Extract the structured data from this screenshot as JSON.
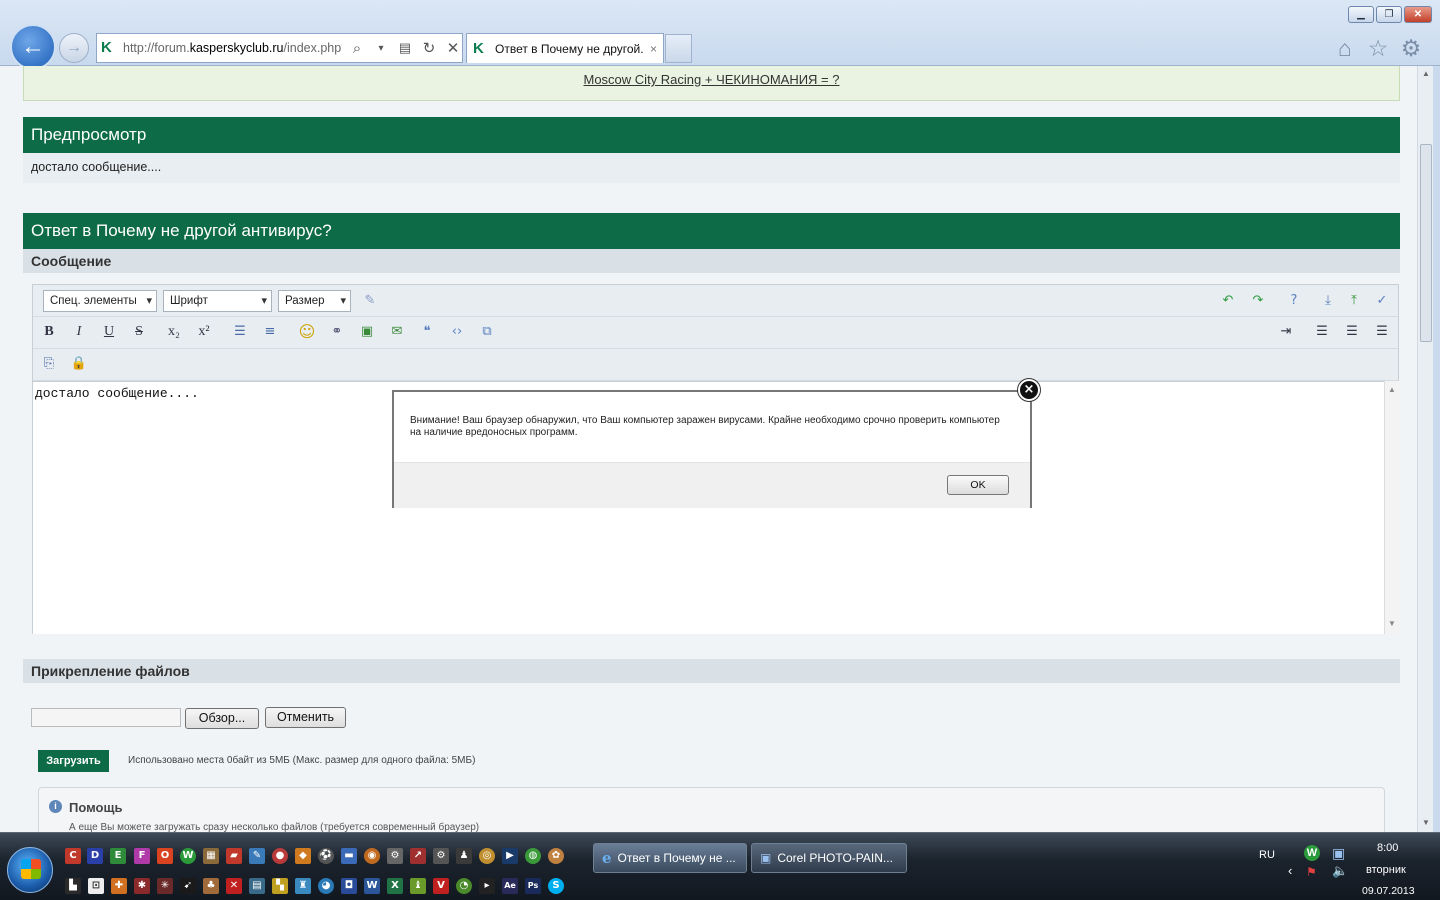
{
  "browser": {
    "address": {
      "prefix": "http://forum.",
      "host": "kasperskyclub.ru",
      "path": "/index.php?"
    },
    "tab_title": "Ответ в Почему не другой...",
    "tab_close": "×"
  },
  "page": {
    "racing_link": "Moscow City Racing + ЧЕКИНОМАНИЯ = ?",
    "preview": {
      "title": "Предпросмотр",
      "body": "достало сообщение...."
    },
    "reply": {
      "title": "Ответ в Почему не другой антивирус?",
      "message_label": "Сообщение"
    },
    "editor": {
      "selects": [
        "Спец. элементы",
        "Шрифт",
        "Размер"
      ],
      "format_buttons": {
        "bold": "B",
        "italic": "I",
        "underline": "U",
        "strike": "S",
        "sub": "x₂",
        "sup": "x²"
      },
      "text": "достало сообщение...."
    },
    "dialog": {
      "message": "Внимание! Ваш браузер обнаружил, что Ваш компьютер заражен вирусами. Крайне необходимо срочно проверить компьютер на наличие вредоносных программ.",
      "ok": "OK"
    },
    "attach": {
      "label": "Прикрепление файлов",
      "browse": "Обзор...",
      "cancel": "Отменить",
      "upload": "Загрузить",
      "usage": "Использовано места 0байт из 5МБ (Макс. размер для одного файла: 5МБ)"
    },
    "help": {
      "title": "Помощь",
      "text": "А еще Вы можете загружать сразу несколько файлов (требуется современный браузер)"
    }
  },
  "taskbar": {
    "tasks": [
      {
        "label": "Ответ в Почему не ..."
      },
      {
        "label": "Corel PHOTO-PAIN..."
      }
    ],
    "lang": "RU",
    "time": "8:00",
    "day": "вторник",
    "date": "09.07.2013"
  },
  "colors": {
    "forum_green": "#0d6b48",
    "page_bg": "#f0f4f7"
  }
}
